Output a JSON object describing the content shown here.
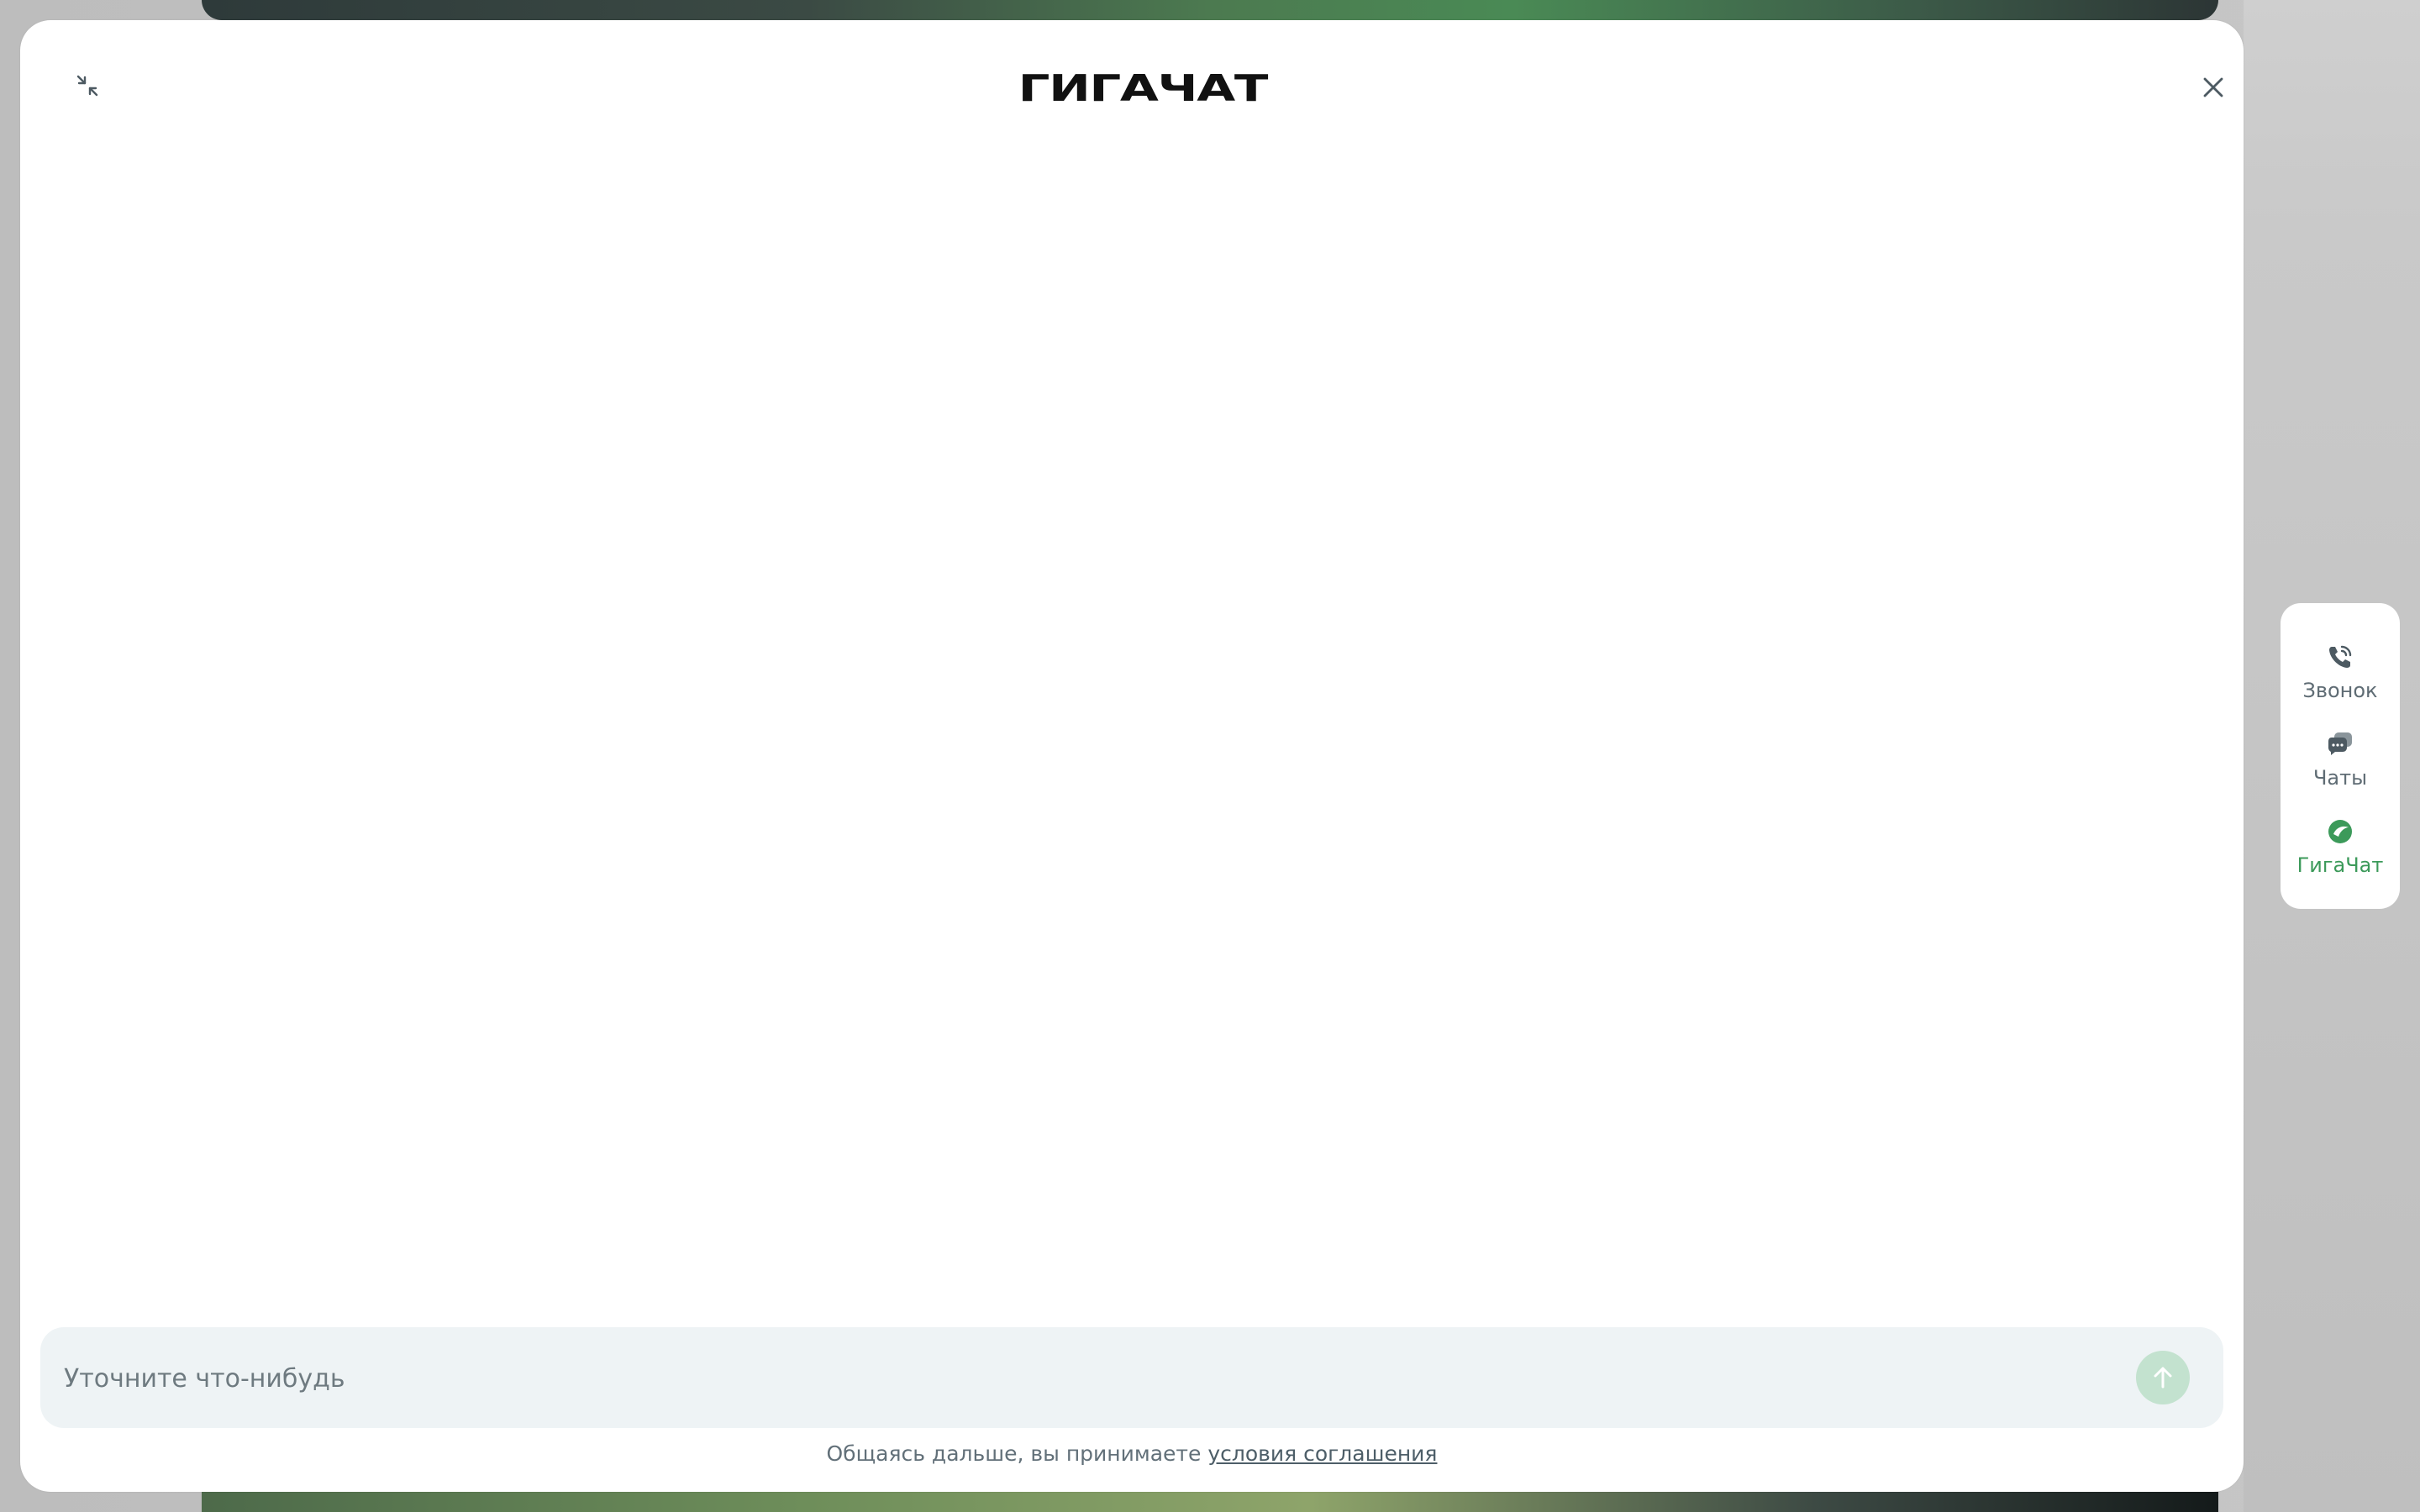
{
  "header": {
    "logo_text": "ГИГАЧАТ",
    "collapse_icon": "collapse-arrows-icon",
    "close_icon": "close-icon"
  },
  "composer": {
    "placeholder": "Уточните что-нибудь",
    "value": "",
    "send_icon": "arrow-up-icon"
  },
  "footer": {
    "terms_prefix": "Общаясь дальше, вы принимаете ",
    "terms_link": "условия соглашения"
  },
  "side_panel": {
    "items": [
      {
        "label": "Звонок",
        "icon": "phone-icon",
        "active": false
      },
      {
        "label": "Чаты",
        "icon": "chats-icon",
        "active": false
      },
      {
        "label": "ГигаЧат",
        "icon": "gigachat-icon",
        "active": true
      }
    ]
  },
  "colors": {
    "accent": "#3c9a5a",
    "send_button": "#c3e2cf",
    "input_bg": "#eef3f5",
    "muted_text": "#5f6c74"
  }
}
